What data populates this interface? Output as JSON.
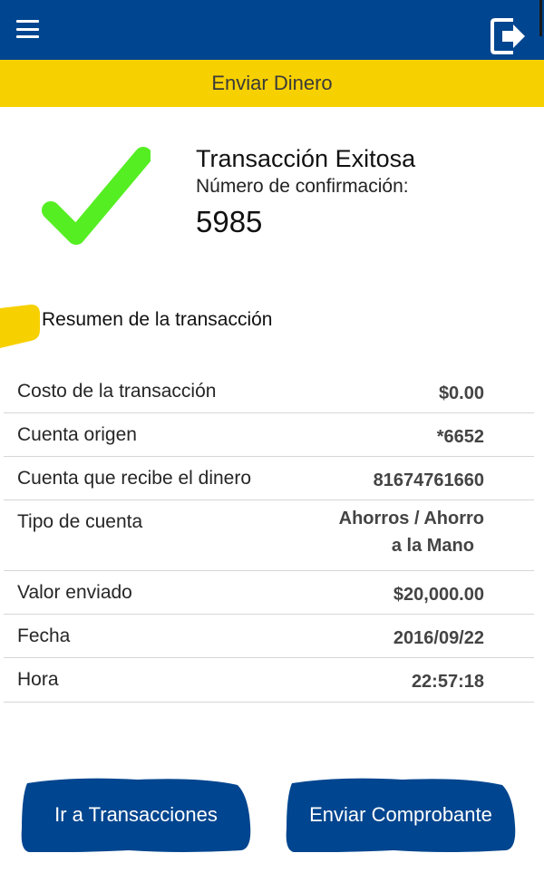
{
  "header": {
    "menu_icon": "hamburger-menu-icon",
    "logout_icon": "logout-exit-icon",
    "title": "Enviar Dinero"
  },
  "colors": {
    "primary_blue": "#00458f",
    "accent_yellow": "#f7d000",
    "success_green": "#55ee22"
  },
  "status": {
    "icon": "check-icon",
    "title": "Transacción Exitosa",
    "confirmation_label": "Número de confirmación:",
    "confirmation_number": "5985"
  },
  "summary": {
    "title": "Resumen de la transacción",
    "rows": [
      {
        "label": "Costo de la transacción",
        "value": "$0.00"
      },
      {
        "label": "Cuenta origen",
        "value": "*6652"
      },
      {
        "label": "Cuenta que recibe el dinero",
        "value": "81674761660"
      },
      {
        "label": "Tipo de cuenta",
        "value_line1": "Ahorros / Ahorro",
        "value_line2": "a la Mano"
      },
      {
        "label": "Valor enviado",
        "value": "$20,000.00"
      },
      {
        "label": "Fecha",
        "value": "2016/09/22"
      },
      {
        "label": "Hora",
        "value": "22:57:18"
      }
    ]
  },
  "actions": {
    "transactions_label": "Ir a Transacciones",
    "receipt_label": "Enviar Comprobante"
  }
}
